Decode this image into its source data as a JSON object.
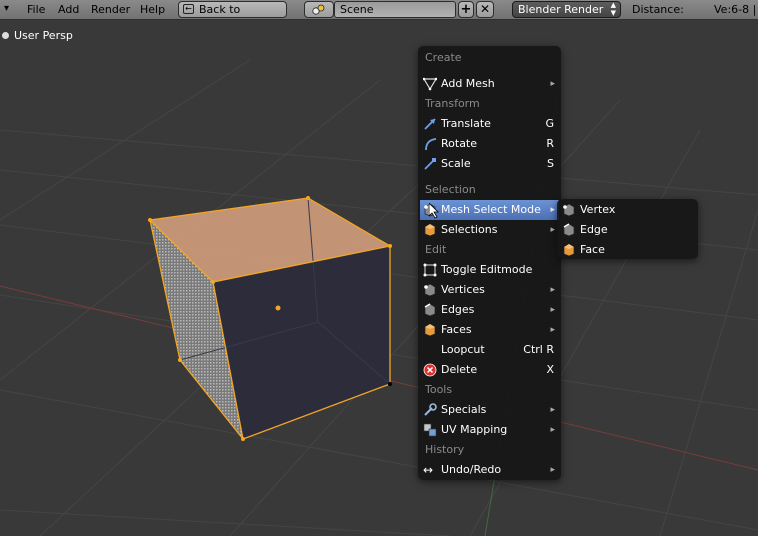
{
  "header": {
    "menus": [
      "File",
      "Add",
      "Render",
      "Help"
    ],
    "back_button": "Back to Previous",
    "scene_name": "Scene",
    "render_engine": "Blender Render",
    "distance_label": "Distance:",
    "stats": "Ve:6-8 |"
  },
  "viewport": {
    "label": "User Persp"
  },
  "menu": {
    "sections": {
      "create": "Create",
      "transform": "Transform",
      "selection": "Selection",
      "edit": "Edit",
      "tools": "Tools",
      "history": "History"
    },
    "items": {
      "add_mesh": "Add Mesh",
      "translate": "Translate",
      "translate_sc": "G",
      "rotate": "Rotate",
      "rotate_sc": "R",
      "scale": "Scale",
      "scale_sc": "S",
      "mesh_select_mode": "Mesh Select Mode",
      "selections": "Selections",
      "toggle_editmode": "Toggle Editmode",
      "vertices": "Vertices",
      "edges": "Edges",
      "faces": "Faces",
      "loopcut": "Loopcut",
      "loopcut_sc": "Ctrl R",
      "delete": "Delete",
      "delete_sc": "X",
      "specials": "Specials",
      "uv_mapping": "UV Mapping",
      "undo_redo": "Undo/Redo"
    }
  },
  "submenu": {
    "items": [
      "Vertex",
      "Edge",
      "Face"
    ]
  },
  "colors": {
    "highlight": "#5680c2",
    "selection": "#f5a623",
    "menu_bg": "#161616"
  }
}
